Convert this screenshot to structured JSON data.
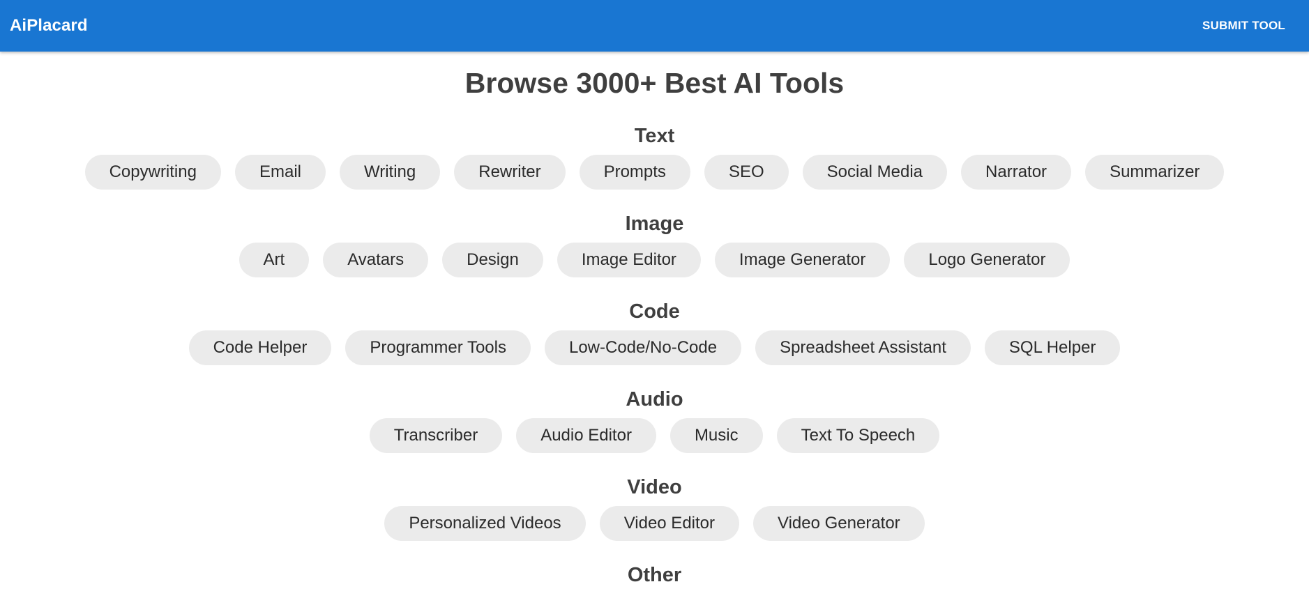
{
  "header": {
    "brand": "AiPlacard",
    "submit_label": "SUBMIT TOOL"
  },
  "main": {
    "title": "Browse 3000+ Best AI Tools",
    "categories": [
      {
        "title": "Text",
        "tags": [
          "Copywriting",
          "Email",
          "Writing",
          "Rewriter",
          "Prompts",
          "SEO",
          "Social Media",
          "Narrator",
          "Summarizer"
        ]
      },
      {
        "title": "Image",
        "tags": [
          "Art",
          "Avatars",
          "Design",
          "Image Editor",
          "Image Generator",
          "Logo Generator"
        ]
      },
      {
        "title": "Code",
        "tags": [
          "Code Helper",
          "Programmer Tools",
          "Low-Code/No-Code",
          "Spreadsheet Assistant",
          "SQL Helper"
        ]
      },
      {
        "title": "Audio",
        "tags": [
          "Transcriber",
          "Audio Editor",
          "Music",
          "Text To Speech"
        ]
      },
      {
        "title": "Video",
        "tags": [
          "Personalized Videos",
          "Video Editor",
          "Video Generator"
        ]
      },
      {
        "title": "Other",
        "tags": []
      }
    ]
  },
  "colors": {
    "appbar": "#1976d2",
    "chip_bg": "#ebebeb",
    "heading_text": "#3f3f3f"
  }
}
